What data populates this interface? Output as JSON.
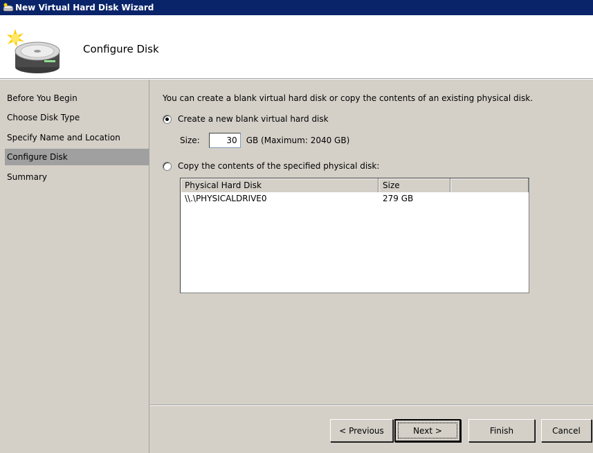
{
  "window": {
    "title": "New Virtual Hard Disk Wizard"
  },
  "header": {
    "title": "Configure Disk",
    "icon": "disk-wizard-icon"
  },
  "sidebar": {
    "items": [
      {
        "label": "Before You Begin",
        "active": false
      },
      {
        "label": "Choose Disk Type",
        "active": false
      },
      {
        "label": "Specify Name and Location",
        "active": false
      },
      {
        "label": "Configure Disk",
        "active": true
      },
      {
        "label": "Summary",
        "active": false
      }
    ]
  },
  "main": {
    "intro": "You can create a blank virtual hard disk or copy the contents of an existing physical disk.",
    "option_new": {
      "label": "Create a new blank virtual hard disk",
      "checked": true
    },
    "size": {
      "label": "Size:",
      "value": "30",
      "suffix": "GB (Maximum: 2040 GB)"
    },
    "option_copy": {
      "label": "Copy the contents of the specified physical disk:",
      "checked": false
    },
    "disk_list": {
      "columns": [
        "Physical Hard Disk",
        "Size",
        ""
      ],
      "rows": [
        {
          "disk": "\\\\.\\PHYSICALDRIVE0",
          "size": "279 GB"
        }
      ]
    }
  },
  "buttons": {
    "previous": "< Previous",
    "next": "Next >",
    "finish": "Finish",
    "cancel": "Cancel"
  }
}
